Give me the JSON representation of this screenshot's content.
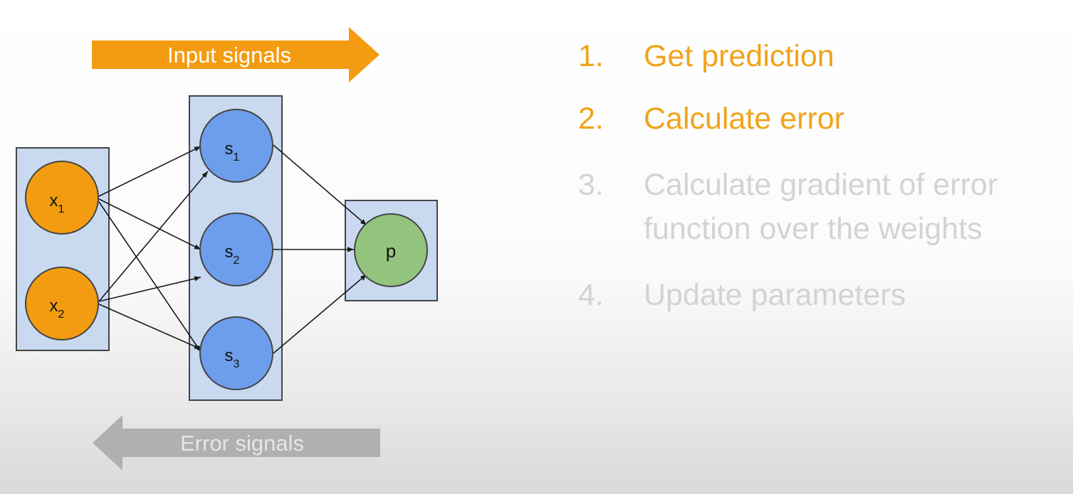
{
  "diagram": {
    "input_arrow_label": "Input signals",
    "error_arrow_label": "Error signals",
    "input_nodes": [
      {
        "base": "x",
        "sub": "1"
      },
      {
        "base": "x",
        "sub": "2"
      }
    ],
    "hidden_nodes": [
      {
        "base": "s",
        "sub": "1"
      },
      {
        "base": "s",
        "sub": "2"
      },
      {
        "base": "s",
        "sub": "3"
      }
    ],
    "output_node": {
      "label": "p"
    },
    "colors": {
      "input_arrow": "#f39c12",
      "error_arrow": "#b0b0b0",
      "input_node": "#f39c12",
      "hidden_node": "#6d9eeb",
      "output_node": "#93c47d",
      "layer_box": "#c9daf0"
    }
  },
  "steps": [
    {
      "number": "1.",
      "text": "Get prediction",
      "state": "active"
    },
    {
      "number": "2.",
      "text": "Calculate error",
      "state": "active"
    },
    {
      "number": "3.",
      "text_lines": [
        "Calculate gradient of error",
        "function over the weights"
      ],
      "state": "inactive"
    },
    {
      "number": "4.",
      "text": "Update parameters",
      "state": "inactive"
    }
  ]
}
